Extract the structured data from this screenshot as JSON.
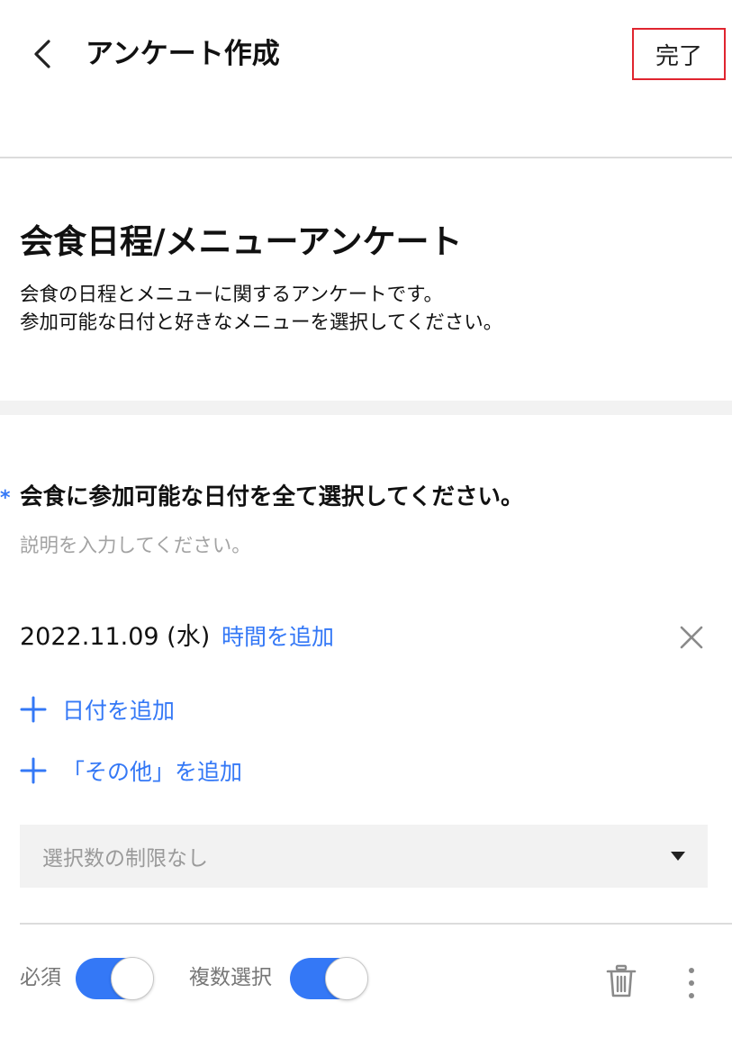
{
  "header": {
    "title": "アンケート作成",
    "done_label": "完了"
  },
  "survey": {
    "title": "会食日程/メニューアンケート",
    "description_lines": [
      "会食の日程とメニューに関するアンケートです。",
      "参加可能な日付と好きなメニューを選択してください。"
    ]
  },
  "question": {
    "required_mark": "*",
    "title": "会食に参加可能な日付を全て選択してください。",
    "description_placeholder": "説明を入力してください。",
    "dates": [
      {
        "date": "2022.11.09 (水)",
        "add_time_label": "時間を追加"
      }
    ],
    "add_date_label": "日付を追加",
    "add_other_label": "「その他」を追加",
    "limit_select": {
      "value": "選択数の制限なし"
    },
    "required_toggle": {
      "label": "必須",
      "on": true
    },
    "multi_toggle": {
      "label": "複数選択",
      "on": true
    }
  },
  "colors": {
    "accent": "#3478f6",
    "done_border": "#e0252f",
    "placeholder": "#a3a3a3",
    "band": "#f2f2f2"
  },
  "icons": [
    "back-chevron-icon",
    "close-icon",
    "plus-icon",
    "caret-down-icon",
    "trash-icon",
    "more-vertical-icon"
  ]
}
